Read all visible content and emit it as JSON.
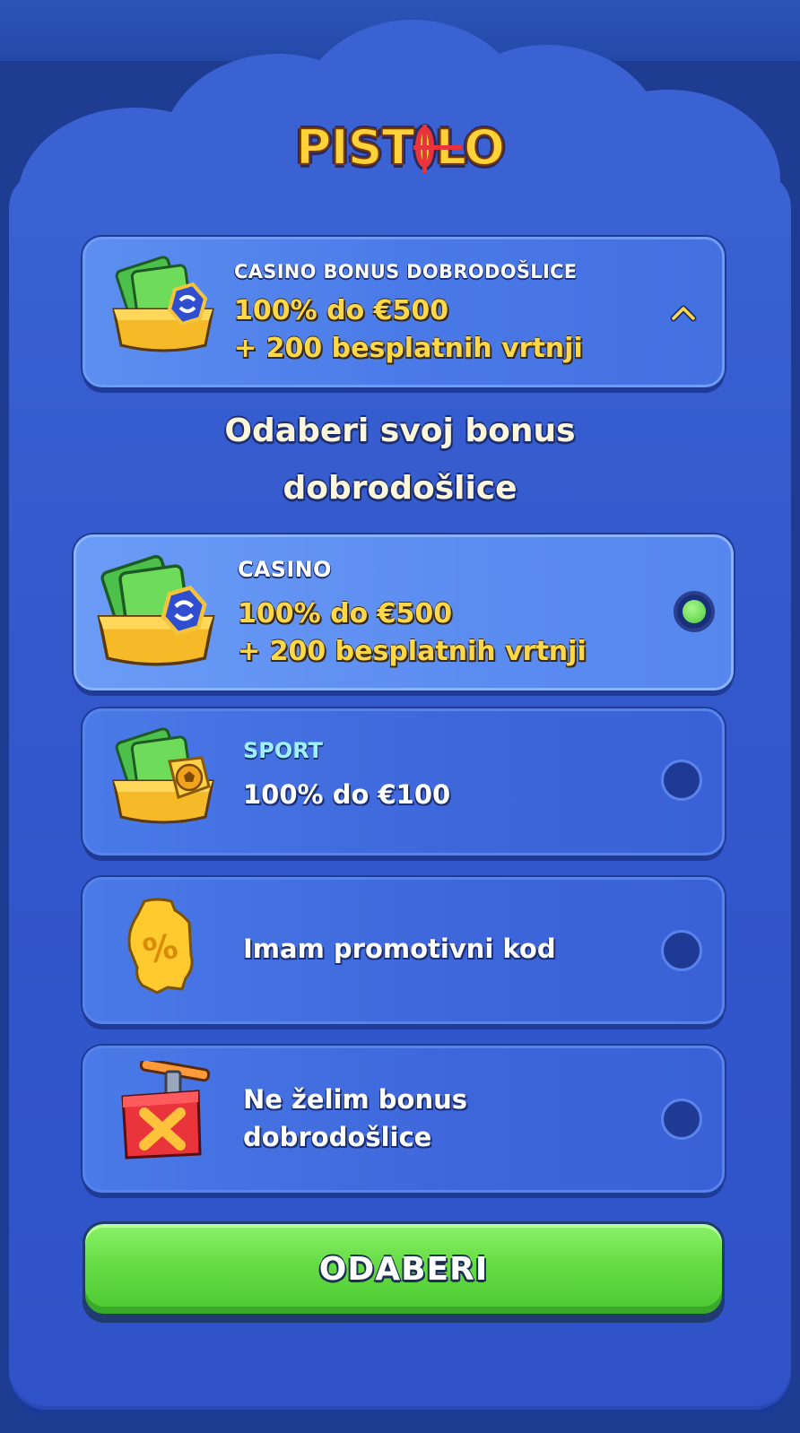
{
  "brand": {
    "logo_text_left": "PIST",
    "logo_text_right": "LO",
    "colors": {
      "panel": "#3358cc",
      "gold": "#ffd84a",
      "green": "#66dc44"
    }
  },
  "header_card": {
    "title": "CASINO BONUS DOBRODOŠLICE",
    "line1": "100% do €500",
    "line2": "+ 200 besplatnih vrtnji",
    "icon": "cash-chest-icon",
    "toggle_icon": "chevron-up-icon"
  },
  "heading": {
    "line1": "Odaberi svoj bonus",
    "line2": "dobrodošlice"
  },
  "options": [
    {
      "title": "CASINO",
      "line1": "100% do €500",
      "line2": "+ 200 besplatnih vrtnji",
      "selected": true,
      "icon": "casino-cash-chest-icon"
    },
    {
      "title": "SPORT",
      "line1": "100% do €100",
      "selected": false,
      "icon": "sport-cash-chest-icon"
    },
    {
      "label": "Imam promotivni kod",
      "selected": false,
      "icon": "promo-ticket-icon"
    },
    {
      "label_line1": "Ne želim bonus",
      "label_line2": "dobrodošlice",
      "selected": false,
      "icon": "detonator-icon"
    }
  ],
  "cta": {
    "label": "ODABERI"
  }
}
